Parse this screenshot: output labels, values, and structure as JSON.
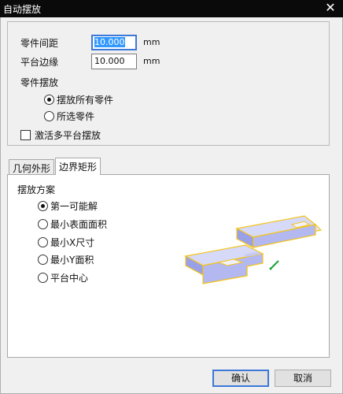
{
  "window": {
    "title": "自动摆放",
    "close_glyph": "✕"
  },
  "spacing": {
    "part_gap_label": "零件间距",
    "part_gap_value": "10.000",
    "platform_margin_label": "平台边缘",
    "platform_margin_value": "10.000",
    "unit": "mm"
  },
  "placement": {
    "section_label": "零件摆放",
    "options": [
      {
        "label": "摆放所有零件",
        "selected": true
      },
      {
        "label": "所选零件",
        "selected": false
      }
    ],
    "multi_platform_label": "激活多平台摆放",
    "multi_platform_checked": false
  },
  "tabs": [
    {
      "label": "几何外形",
      "active": false
    },
    {
      "label": "边界矩形",
      "active": true
    }
  ],
  "scheme": {
    "section_label": "摆放方案",
    "options": [
      {
        "label": "第一可能解",
        "selected": true
      },
      {
        "label": "最小表面面积",
        "selected": false
      },
      {
        "label": "最小X尺寸",
        "selected": false
      },
      {
        "label": "最小Y面积",
        "selected": false
      },
      {
        "label": "平台中心",
        "selected": false
      }
    ]
  },
  "buttons": {
    "ok": "确认",
    "cancel": "取消"
  },
  "colors": {
    "accent": "#3c78d8",
    "part_fill": "#b8bdf2",
    "bbox": "#f5c518",
    "axis_green": "#1aa23a"
  }
}
